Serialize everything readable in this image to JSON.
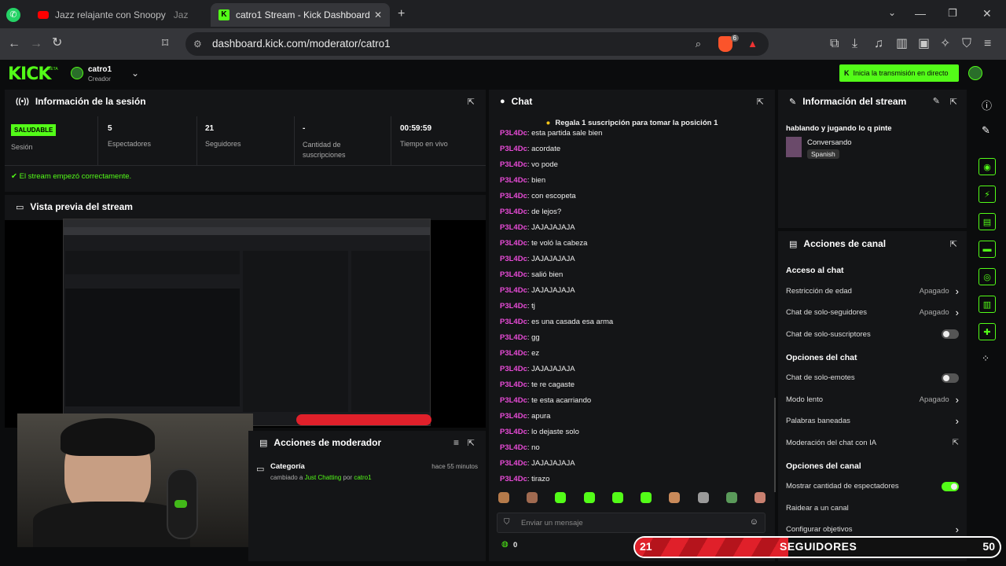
{
  "browser": {
    "tabs": [
      {
        "label": "Jazz relajante con Snoopy"
      },
      {
        "label": "Jaz"
      },
      {
        "label": "catro1 Stream - Kick Dashboard"
      }
    ],
    "url": "dashboard.kick.com/moderator/catro1",
    "badge_count": "6"
  },
  "header": {
    "logo": "KICK",
    "logo_sup": "BETA",
    "user": "catro1",
    "role": "Creador",
    "golive_label": "Inicia la transmisión en directo"
  },
  "session": {
    "title": "Información de la sesión",
    "status_badge": "SALUDABLE",
    "status_label": "Sesión",
    "stats": [
      {
        "value": "5",
        "label": "Espectadores"
      },
      {
        "value": "21",
        "label": "Seguidores"
      },
      {
        "value": "-",
        "label": "Cantidad de suscripciones"
      },
      {
        "value": "00:59:59",
        "label": "Tiempo en vivo"
      }
    ],
    "message": "El stream empezó correctamente."
  },
  "preview": {
    "title": "Vista previa del stream"
  },
  "modactions": {
    "title": "Acciones de moderador",
    "item_title": "Categoría",
    "item_time": "hace 55 minutos",
    "item_prefix": "cambiado a",
    "item_category": "Just Chatting",
    "item_by": "por",
    "item_user": "catro1"
  },
  "chat": {
    "title": "Chat",
    "pinned": "Regala 1 suscripción para tomar la posición 1",
    "username": "P3L4Dc",
    "messages": [
      "esta partida sale bien",
      "acordate",
      "vo pode",
      "bien",
      "con escopeta",
      "de lejos?",
      "JAJAJAJAJA",
      "te voló la cabeza",
      "JAJAJAJAJA",
      "salió bien",
      "JAJAJAJAJA",
      "tj",
      "es una casada esa arma",
      "gg",
      "ez",
      "JAJAJAJAJA",
      "te re cagaste",
      "te esta acarriando",
      "apura",
      "lo dejaste solo",
      "no",
      "JAJAJAJAJA",
      "tirazo"
    ],
    "input_placeholder": "Enviar un mensaje",
    "viewer_count": "0"
  },
  "streaminfo": {
    "title": "Información del stream",
    "stream_title": "hablando y jugando lo q pinte",
    "category": "Conversando",
    "language": "Spanish"
  },
  "channel": {
    "title": "Acciones de canal",
    "sections": [
      {
        "heading": "Acceso al chat",
        "rows": [
          {
            "label": "Restricción de edad",
            "value": "Apagado",
            "kind": "arrow"
          },
          {
            "label": "Chat de solo-seguidores",
            "value": "Apagado",
            "kind": "arrow"
          },
          {
            "label": "Chat de solo-suscriptores",
            "value": "",
            "kind": "toggle-off"
          }
        ]
      },
      {
        "heading": "Opciones del chat",
        "rows": [
          {
            "label": "Chat de solo-emotes",
            "value": "",
            "kind": "toggle-off"
          },
          {
            "label": "Modo lento",
            "value": "Apagado",
            "kind": "arrow"
          },
          {
            "label": "Palabras baneadas",
            "value": "",
            "kind": "arrow"
          },
          {
            "label": "Moderación del chat con IA",
            "value": "",
            "kind": "external"
          }
        ]
      },
      {
        "heading": "Opciones del canal",
        "rows": [
          {
            "label": "Mostrar cantidad de espectadores",
            "value": "",
            "kind": "toggle-on"
          },
          {
            "label": "Raidear a un canal",
            "value": "",
            "kind": "none"
          },
          {
            "label": "Configurar objetivos",
            "value": "",
            "kind": "arrow"
          }
        ]
      }
    ]
  },
  "goal": {
    "current": "21",
    "label": "SEGUIDORES",
    "target": "50",
    "progress": 0.42
  },
  "colors": {
    "accent": "#53fc18",
    "username": "#e94bd8",
    "goal": "#e0202a"
  }
}
